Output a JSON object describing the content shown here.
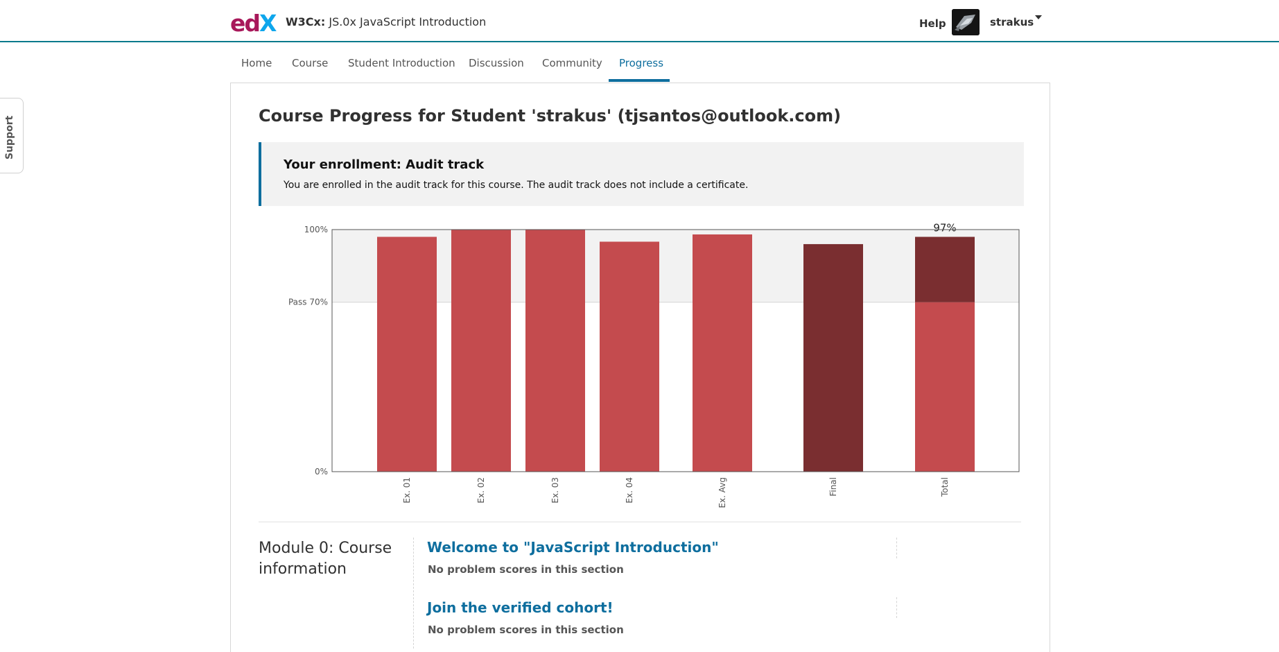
{
  "header": {
    "logo_text": "edX",
    "course_org": "W3Cx:",
    "course_name": "JS.0x JavaScript Introduction",
    "help_label": "Help",
    "username": "strakus"
  },
  "support_tab": {
    "label": "Support"
  },
  "tabs": [
    {
      "label": "Home"
    },
    {
      "label": "Course"
    },
    {
      "label": "Student Introduction"
    },
    {
      "label": "Discussion"
    },
    {
      "label": "Community"
    },
    {
      "label": "Progress"
    }
  ],
  "page_title": "Course Progress for Student 'strakus' (tjsantos@outlook.com)",
  "enrollment": {
    "title": "Your enrollment: Audit track",
    "text": "You are enrolled in the audit track for this course. The audit track does not include a certificate."
  },
  "colors": {
    "bar": "#c44b4e",
    "bar_dark": "#7a2e30",
    "pass_band": "#f2f2f2",
    "accent": "#0e6e9e"
  },
  "chart_data": {
    "type": "bar",
    "categories": [
      "Ex. 01",
      "Ex. 02",
      "Ex. 03",
      "Ex. 04",
      "Ex. Avg",
      "Final",
      "Total"
    ],
    "values": [
      97,
      100,
      100,
      95,
      98,
      94,
      97
    ],
    "ylim": [
      0,
      100
    ],
    "yticks": [
      {
        "value": 0,
        "label": "0%"
      },
      {
        "value": 70,
        "label": "Pass 70%"
      },
      {
        "value": 100,
        "label": "100%"
      }
    ],
    "total_label": "97%",
    "total_stack_split": 70
  },
  "module": {
    "title": "Module 0: Course information",
    "sections": [
      {
        "title": "Welcome to \"JavaScript Introduction\"",
        "note": "No problem scores in this section"
      },
      {
        "title": "Join the verified cohort!",
        "note": "No problem scores in this section"
      }
    ]
  }
}
